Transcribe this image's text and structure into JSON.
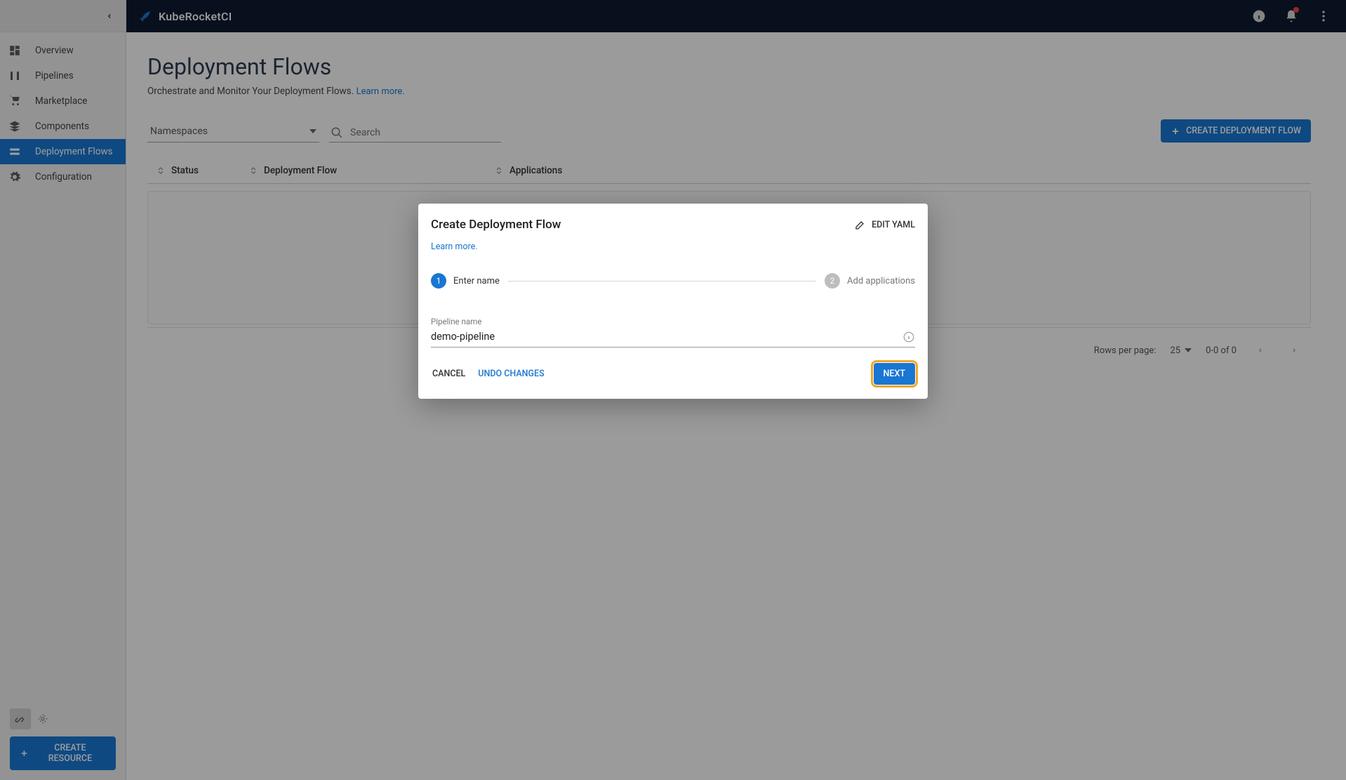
{
  "brand": "KubeRocketCI",
  "sidebar": {
    "items": [
      {
        "label": "Overview"
      },
      {
        "label": "Pipelines"
      },
      {
        "label": "Marketplace"
      },
      {
        "label": "Components"
      },
      {
        "label": "Deployment Flows"
      },
      {
        "label": "Configuration"
      }
    ],
    "create_resource": "CREATE RESOURCE"
  },
  "page": {
    "title": "Deployment Flows",
    "subtitle": "Orchestrate and Monitor Your Deployment Flows.",
    "learn_more": "Learn more."
  },
  "filters": {
    "namespaces_label": "Namespaces",
    "search_placeholder": "Search"
  },
  "buttons": {
    "create_flow": "CREATE DEPLOYMENT FLOW"
  },
  "table": {
    "columns": [
      "Status",
      "Deployment Flow",
      "Applications"
    ]
  },
  "pagination": {
    "rows_label": "Rows per page:",
    "rows_value": "25",
    "range": "0-0 of 0"
  },
  "dialog": {
    "title": "Create Deployment Flow",
    "edit_yaml": "EDIT YAML",
    "learn_more": "Learn more.",
    "steps": [
      {
        "num": "1",
        "label": "Enter name"
      },
      {
        "num": "2",
        "label": "Add applications"
      }
    ],
    "field": {
      "label": "Pipeline name",
      "value": "demo-pipeline"
    },
    "actions": {
      "cancel": "CANCEL",
      "undo": "UNDO CHANGES",
      "next": "NEXT"
    }
  }
}
